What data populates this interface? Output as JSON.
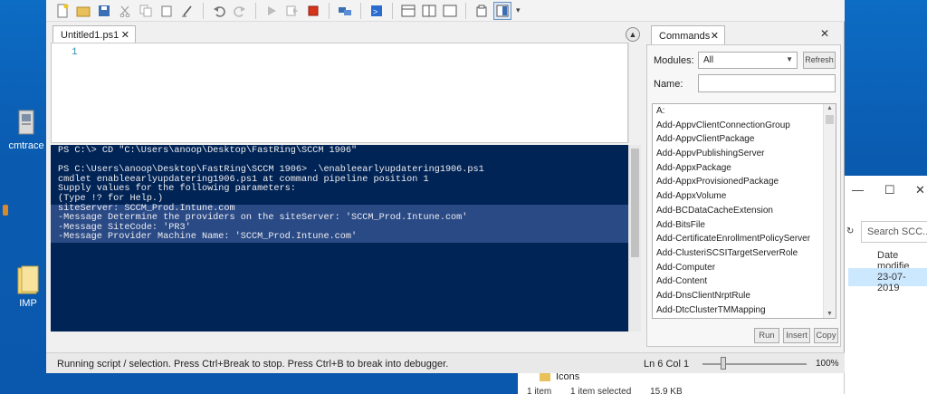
{
  "desktop": {
    "icons": [
      {
        "label": "cmtrace"
      },
      {
        "label": "IMP"
      }
    ]
  },
  "explorer": {
    "search_placeholder": "Search SCC...",
    "column_header": "Date modifie",
    "date_value": "23-07-2019",
    "folder_name": "Icons",
    "status": {
      "items": "1 item",
      "selected": "1 item selected",
      "size": "15.9 KB"
    }
  },
  "ise": {
    "script_tab": {
      "title": "Untitled1.ps1"
    },
    "editor": {
      "line_number": "1"
    },
    "console_lines": [
      "PS C:\\> CD \"C:\\Users\\anoop\\Desktop\\FastRing\\SCCM 1906\"",
      "",
      "PS C:\\Users\\anoop\\Desktop\\FastRing\\SCCM 1906> .\\enableearlyupdatering1906.ps1",
      "cmdlet enableearlyupdatering1906.ps1 at command pipeline position 1",
      "Supply values for the following parameters:",
      "(Type !? for Help.)",
      "siteServer: SCCM_Prod.Intune.com",
      "-Message Determine the providers on the siteServer: 'SCCM_Prod.Intune.com'",
      "-Message SiteCode: 'PR3'",
      "-Message Provider Machine Name: 'SCCM_Prod.Intune.com'"
    ],
    "commands": {
      "tab_title": "Commands",
      "modules_label": "Modules:",
      "modules_value": "All",
      "refresh_label": "Refresh",
      "name_label": "Name:",
      "items": [
        "A:",
        "Add-AppvClientConnectionGroup",
        "Add-AppvClientPackage",
        "Add-AppvPublishingServer",
        "Add-AppxPackage",
        "Add-AppxProvisionedPackage",
        "Add-AppxVolume",
        "Add-BCDataCacheExtension",
        "Add-BitsFile",
        "Add-CertificateEnrollmentPolicyServer",
        "Add-ClusteriSCSITargetServerRole",
        "Add-Computer",
        "Add-Content",
        "Add-DnsClientNrptRule",
        "Add-DtcClusterTMMapping"
      ],
      "run_label": "Run",
      "insert_label": "Insert",
      "copy_label": "Copy"
    },
    "status": {
      "message": "Running script / selection.  Press Ctrl+Break to stop.  Press Ctrl+B to break into debugger.",
      "position": "Ln 6  Col 1",
      "zoom": "100%"
    }
  },
  "colors": {
    "console_bg": "#012456",
    "desktop_bg": "#0a5bb0"
  }
}
